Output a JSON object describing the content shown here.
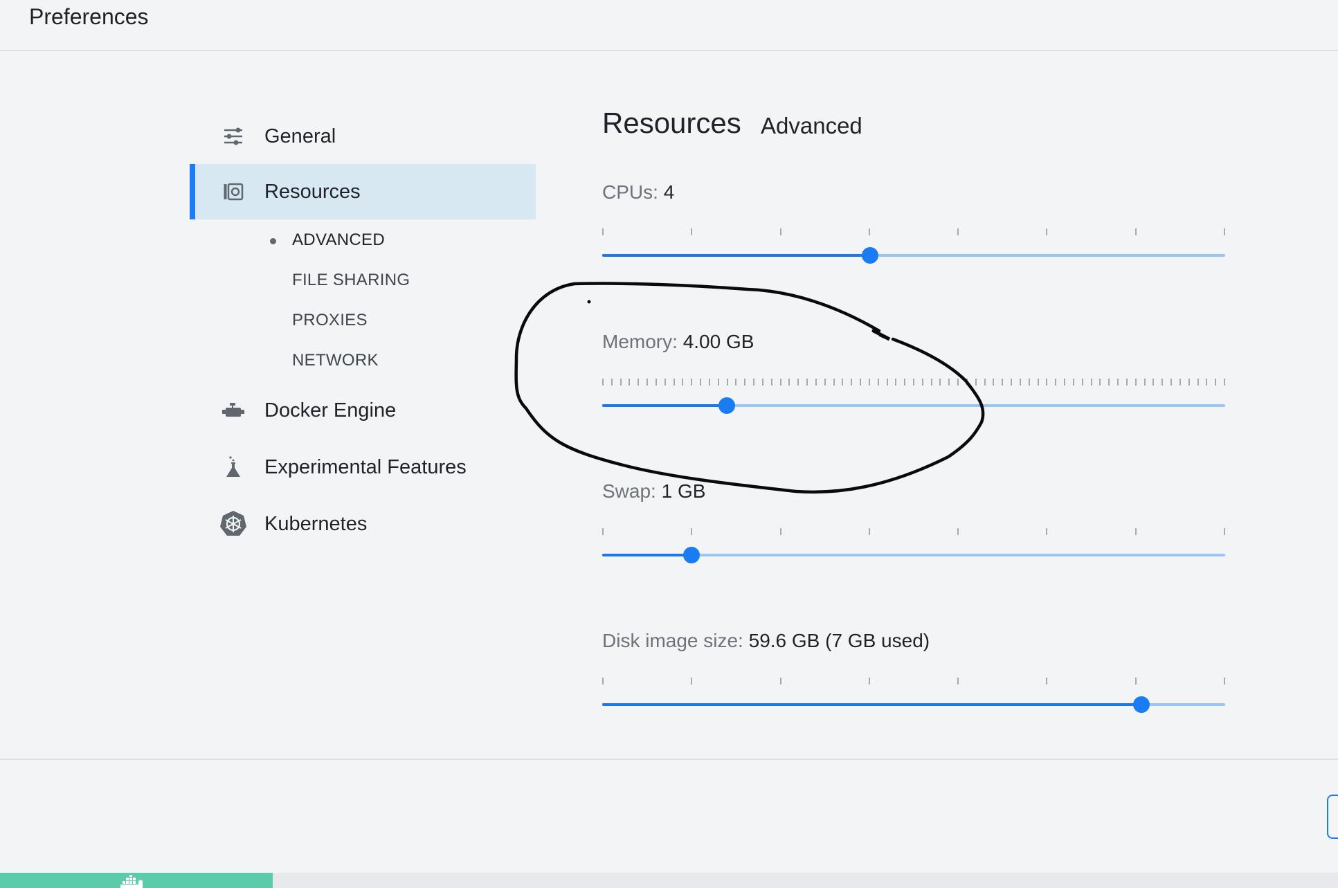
{
  "window": {
    "title": "Preferences"
  },
  "sidebar": {
    "items": [
      {
        "label": "General",
        "icon": "sliders-icon"
      },
      {
        "label": "Resources",
        "icon": "resources-icon",
        "active": true
      },
      {
        "label": "Docker Engine",
        "icon": "engine-icon"
      },
      {
        "label": "Experimental Features",
        "icon": "flask-icon"
      },
      {
        "label": "Kubernetes",
        "icon": "kubernetes-icon"
      }
    ],
    "sub_items": [
      {
        "label": "ADVANCED",
        "active": true
      },
      {
        "label": "FILE SHARING"
      },
      {
        "label": "PROXIES"
      },
      {
        "label": "NETWORK"
      }
    ]
  },
  "main": {
    "section_title": "Resources",
    "tab": "Advanced",
    "settings": {
      "cpus": {
        "label": "CPUs:",
        "value": "4",
        "fraction": 0.43
      },
      "memory": {
        "label": "Memory:",
        "value": "4.00 GB",
        "fraction": 0.2
      },
      "swap": {
        "label": "Swap:",
        "value": "1 GB",
        "fraction": 0.143
      },
      "disk": {
        "label": "Disk image size:",
        "value": "59.6 GB (7 GB used)",
        "fraction": 0.865
      }
    }
  },
  "colors": {
    "accent": "#1a7cf2",
    "active_nav_bg": "#d8e8f2",
    "engine_running": "#5ccbac",
    "annotation_ink": "#000000"
  },
  "annotation": {
    "type": "hand-drawn-ellipse",
    "encloses": "memory-setting"
  }
}
